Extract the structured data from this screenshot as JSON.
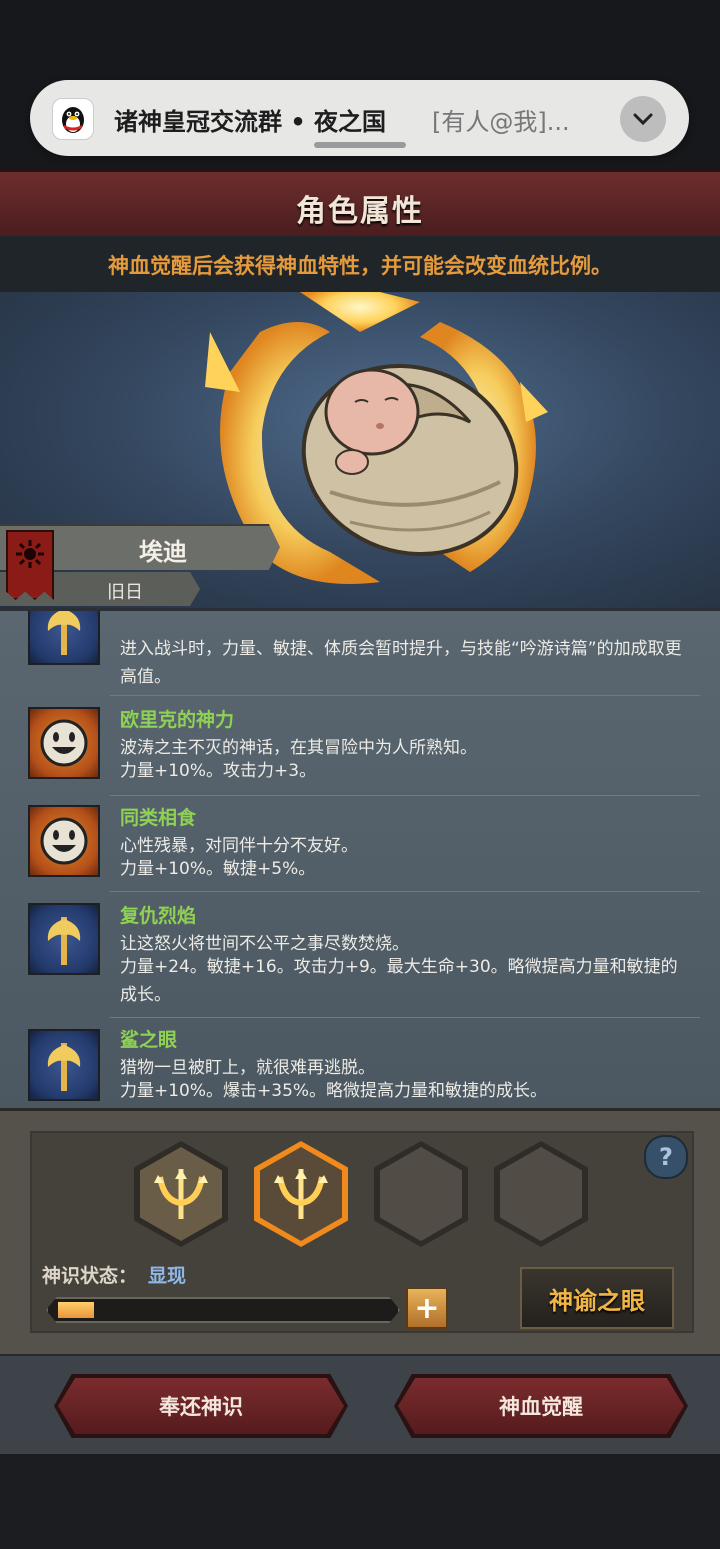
{
  "notification": {
    "title": "诸神皇冠交流群 • 夜之国",
    "message": "[有人@我]...",
    "app_icon": "qq-penguin-icon"
  },
  "header": {
    "title": "角色属性",
    "subtitle": "神血觉醒后会获得神血特性，并可能会改变血统比例。"
  },
  "character": {
    "name": "埃迪",
    "tag": "旧日",
    "portrait": "swaddled-baby-with-flaming-crown"
  },
  "traits": [
    {
      "icon": "axe-icon",
      "name": "",
      "desc": "",
      "stat": "进入战斗时，力量、敏捷、体质会暂时提升，与技能“吟游诗篇”的加成取更高值。"
    },
    {
      "icon": "face-icon",
      "name": "欧里克的神力",
      "desc": "波涛之主不灭的神话，在其冒险中为人所熟知。",
      "stat": "力量+10%。攻击力+3。"
    },
    {
      "icon": "face-icon",
      "name": "同类相食",
      "desc": "心性残暴，对同伴十分不友好。",
      "stat": "力量+10%。敏捷+5%。"
    },
    {
      "icon": "axe-icon",
      "name": "复仇烈焰",
      "desc": "让这怒火将世间不公平之事尽数焚烧。",
      "stat": "力量+24。敏捷+16。攻击力+9。最大生命+30。略微提高力量和敏捷的成长。"
    },
    {
      "icon": "axe-icon",
      "name": "鲨之眼",
      "desc": "猎物一旦被盯上，就很难再逃脱。",
      "stat": "力量+10%。爆击+35%。略微提高力量和敏捷的成长。"
    }
  ],
  "divine": {
    "slots": [
      "trident-emblem",
      "trident-emblem-selected",
      "empty",
      "empty"
    ],
    "state_label": "神识状态：",
    "state_value": "显现",
    "progress": 0.11,
    "plus_label": "+",
    "help_label": "?",
    "oracle_button": "神谕之眼"
  },
  "actions": {
    "return_button": "奉还神识",
    "awaken_button": "神血觉醒"
  },
  "colors": {
    "accent_orange": "#e59a3c",
    "trait_green": "#8ed154",
    "banner_red": "#6e2e2e",
    "state_blue": "#8fb8e8"
  }
}
